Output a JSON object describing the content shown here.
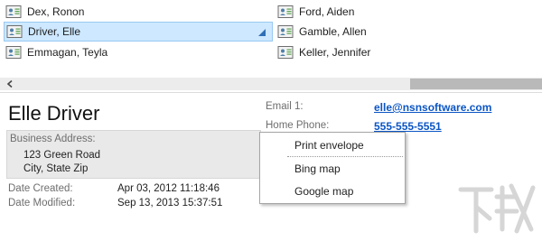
{
  "contacts": {
    "col1": [
      {
        "name": "Dex, Ronon"
      },
      {
        "name": "Driver, Elle"
      },
      {
        "name": "Emmagan, Teyla"
      }
    ],
    "col2": [
      {
        "name": "Ford, Aiden"
      },
      {
        "name": "Gamble, Allen"
      },
      {
        "name": "Keller, Jennifer"
      }
    ],
    "selected": "Driver, Elle"
  },
  "details": {
    "full_name": "Elle Driver",
    "business_address_label": "Business Address:",
    "address_line1": "123 Green Road",
    "address_line2": "City, State Zip",
    "date_created_label": "Date Created:",
    "date_created": "Apr 03, 2012 11:18:46",
    "date_modified_label": "Date Modified:",
    "date_modified": "Sep 13, 2013 15:37:51",
    "email_label": "Email 1:",
    "email": "elle@nsnsoftware.com",
    "home_phone_label": "Home Phone:",
    "home_phone": "555-555-5551"
  },
  "context_menu": {
    "items": [
      "Print envelope",
      "Bing map",
      "Google map"
    ]
  },
  "colors": {
    "selection": "#cde8ff",
    "link": "#0b55c4",
    "address_bg": "#e9e9e9"
  },
  "icons": {
    "contact": "contact-card-icon",
    "scroll_left": "chevron-left-icon",
    "selection_corner": "corner-arrow-icon",
    "watermark": "watermark-logo"
  }
}
